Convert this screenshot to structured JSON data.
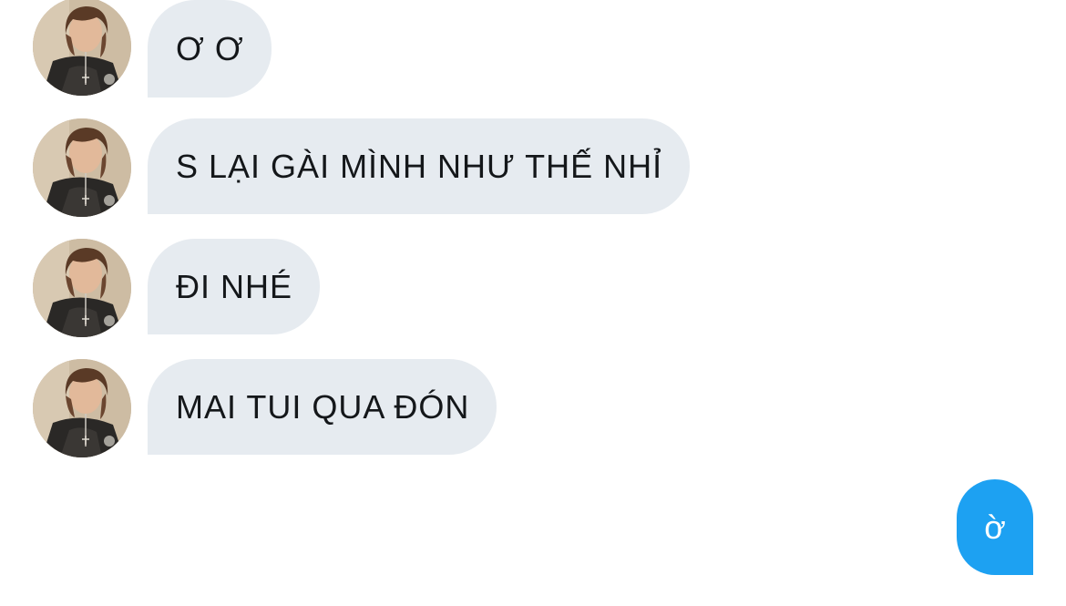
{
  "messages": [
    {
      "direction": "received",
      "text": "Ơ Ơ",
      "avatar": "contact-avatar"
    },
    {
      "direction": "received",
      "text": "S LẠI GÀI MÌNH NHƯ THẾ NHỈ",
      "avatar": "contact-avatar"
    },
    {
      "direction": "received",
      "text": "ĐI NHÉ",
      "avatar": "contact-avatar"
    },
    {
      "direction": "received",
      "text": "MAI TUI QUA ĐÓN",
      "avatar": "contact-avatar"
    },
    {
      "direction": "sent",
      "text": "ờ"
    }
  ],
  "colors": {
    "received_bubble": "#e6ebf0",
    "received_text": "#14171a",
    "sent_bubble": "#1da1f2",
    "sent_text": "#ffffff",
    "background": "#ffffff"
  }
}
